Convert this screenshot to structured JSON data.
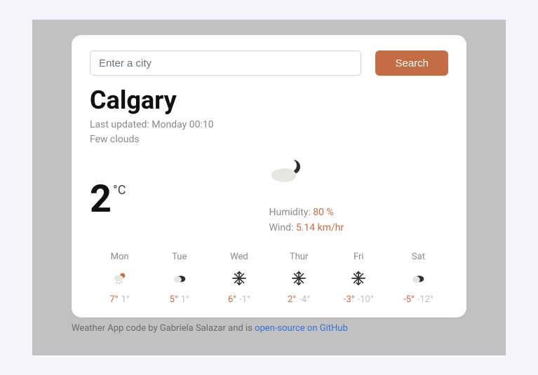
{
  "search": {
    "placeholder": "Enter a city",
    "button": "Search"
  },
  "current": {
    "city": "Calgary",
    "updated_prefix": "Last updated: ",
    "updated": "Monday 00:10",
    "condition": "Few clouds",
    "temp": "2",
    "unit": "°C",
    "humidity_label": "Humidity: ",
    "humidity": "80 %",
    "wind_label": "Wind: ",
    "wind": "5.14 km/hr",
    "icon": "cloud-moon"
  },
  "forecast": [
    {
      "day": "Mon",
      "icon": "snow-sun",
      "hi": "7°",
      "lo": "1°"
    },
    {
      "day": "Tue",
      "icon": "cloud-dark",
      "hi": "5°",
      "lo": "1°"
    },
    {
      "day": "Wed",
      "icon": "snowflake",
      "hi": "6°",
      "lo": "-1°"
    },
    {
      "day": "Thur",
      "icon": "snowflake",
      "hi": "2°",
      "lo": "-4°"
    },
    {
      "day": "Fri",
      "icon": "snowflake",
      "hi": "-3°",
      "lo": "-10°"
    },
    {
      "day": "Sat",
      "icon": "cloud-dark",
      "hi": "-5°",
      "lo": "-12°"
    }
  ],
  "footer": {
    "text": "Weather App code by Gabriela Salazar and is ",
    "link": "open-source on GitHub"
  }
}
